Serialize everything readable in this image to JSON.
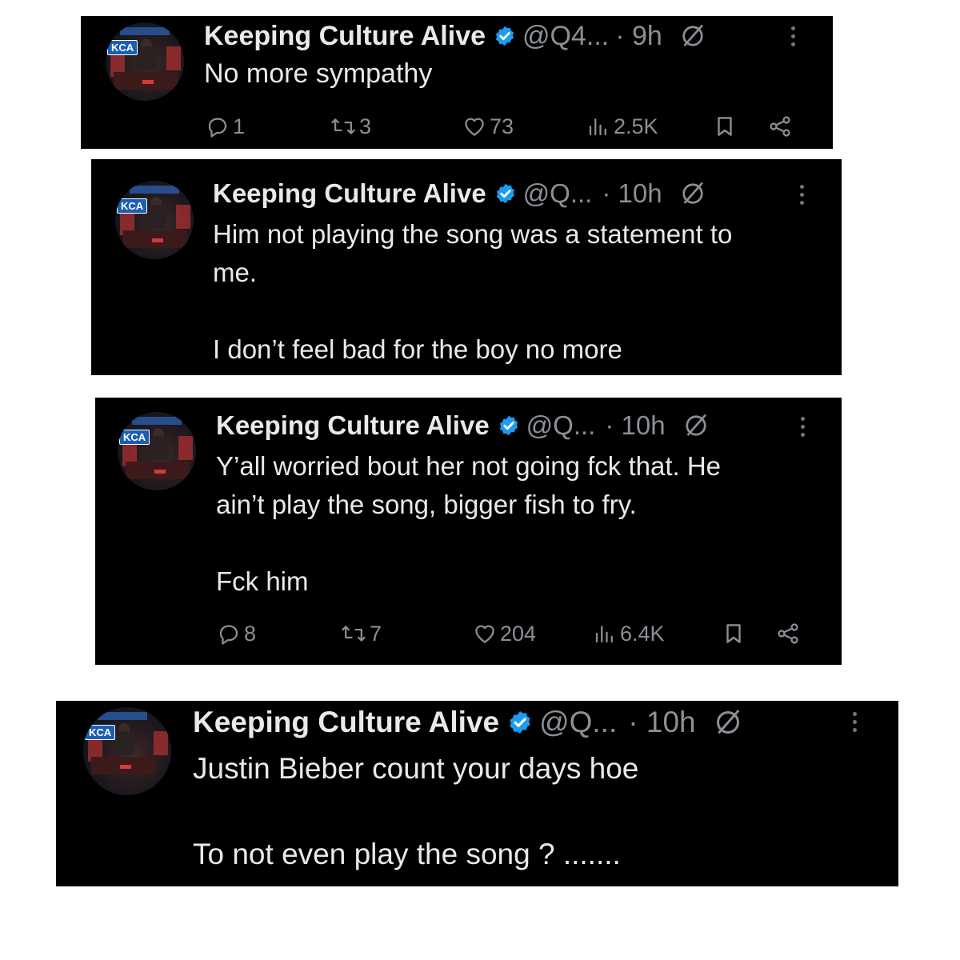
{
  "tweets": [
    {
      "display_name": "Keeping Culture Alive",
      "handle": "@Q4...",
      "time": "· 9h",
      "text": "No more sympathy",
      "avatar_label": "KCA",
      "metrics": {
        "replies": "1",
        "reposts": "3",
        "likes": "73",
        "views": "2.5K"
      }
    },
    {
      "display_name": "Keeping Culture Alive",
      "handle": "@Q...",
      "time": "· 10h",
      "text": "Him not playing the song was a statement to\nme.\n\nI don’t feel bad for the boy no more",
      "avatar_label": "KCA"
    },
    {
      "display_name": "Keeping Culture Alive",
      "handle": "@Q...",
      "time": "· 10h",
      "text": "Y’all worried bout her not going fck that. He\nain’t play the song, bigger fish to fry.\n\nFck him",
      "avatar_label": "KCA",
      "metrics": {
        "replies": "8",
        "reposts": "7",
        "likes": "204",
        "views": "6.4K"
      }
    },
    {
      "display_name": "Keeping Culture Alive",
      "handle": "@Q...",
      "time": "· 10h",
      "text": "Justin Bieber count your days hoe\n\nTo not even play the song ? .......",
      "avatar_label": "KCA"
    }
  ],
  "icons": {
    "verified": "verified-badge-icon",
    "grok": "grok-icon",
    "more": "more-options-icon",
    "reply": "reply-icon",
    "repost": "repost-icon",
    "like": "like-icon",
    "views": "views-icon",
    "bookmark": "bookmark-icon",
    "share": "share-icon"
  },
  "colors": {
    "background": "#000000",
    "text": "#e7e9ea",
    "secondary_text": "#8b9096",
    "verified_blue": "#1d9bf0"
  }
}
